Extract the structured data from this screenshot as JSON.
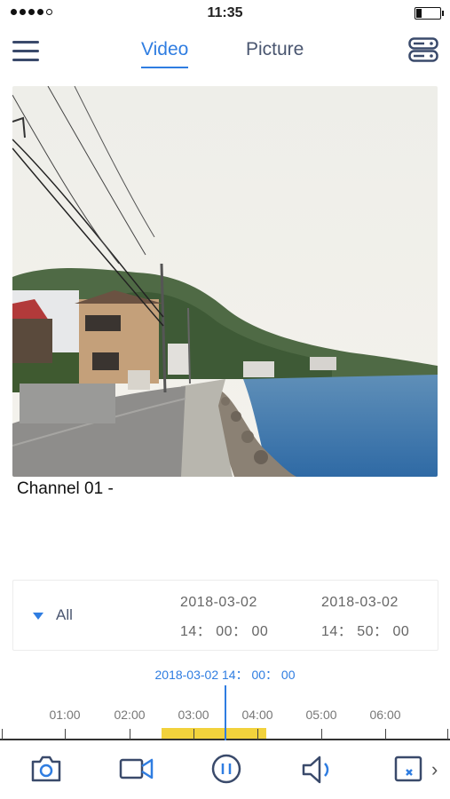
{
  "status_bar": {
    "time": "11:35",
    "signal_dots": 5
  },
  "nav": {
    "tabs": [
      {
        "label": "Video",
        "active": true
      },
      {
        "label": "Picture",
        "active": false
      }
    ]
  },
  "video": {
    "channel_label": "Channel 01 -"
  },
  "filter": {
    "selected": "All",
    "start_date": "2018-03-02",
    "start_time": "14： 00： 00",
    "end_date": "2018-03-02",
    "end_time": "14： 50： 00"
  },
  "timeline": {
    "current": "2018-03-02 14： 00： 00",
    "ticks": [
      "01:00",
      "02:00",
      "03:00",
      "04:00",
      "05:00",
      "06:00"
    ]
  },
  "toolbar": {
    "icons": [
      "camera-snapshot-icon",
      "video-record-icon",
      "pause-icon",
      "speaker-icon",
      "close-window-icon",
      "chevron-right-icon"
    ]
  },
  "colors": {
    "accent": "#2f7de1",
    "recording": "#f2d23c",
    "icon": "#3a4a6b"
  }
}
